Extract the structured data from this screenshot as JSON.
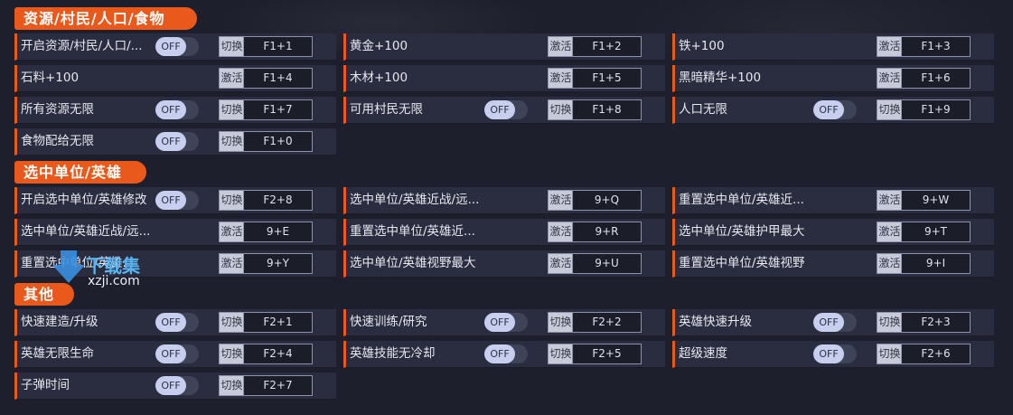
{
  "sections": [
    {
      "title": "资源/村民/人口/食物",
      "rows": [
        [
          {
            "name": "开启资源/村民/人口/...",
            "toggle": "OFF",
            "action": "切换",
            "key": "F1+1"
          },
          {
            "name": "黄金+100",
            "action": "激活",
            "key": "F1+2"
          },
          {
            "name": "铁+100",
            "action": "激活",
            "key": "F1+3"
          }
        ],
        [
          {
            "name": "石料+100",
            "action": "激活",
            "key": "F1+4"
          },
          {
            "name": "木材+100",
            "action": "激活",
            "key": "F1+5"
          },
          {
            "name": "黑暗精华+100",
            "action": "激活",
            "key": "F1+6"
          }
        ],
        [
          {
            "name": "所有资源无限",
            "toggle": "OFF",
            "action": "切换",
            "key": "F1+7"
          },
          {
            "name": "可用村民无限",
            "toggle": "OFF",
            "action": "切换",
            "key": "F1+8"
          },
          {
            "name": "人口无限",
            "toggle": "OFF",
            "action": "切换",
            "key": "F1+9"
          }
        ],
        [
          {
            "name": "食物配给无限",
            "toggle": "OFF",
            "action": "切换",
            "key": "F1+0"
          }
        ]
      ]
    },
    {
      "title": "选中单位/英雄",
      "rows": [
        [
          {
            "name": "开启选中单位/英雄修改",
            "toggle": "OFF",
            "action": "切换",
            "key": "F2+8"
          },
          {
            "name": "选中单位/英雄近战/远...",
            "action": "激活",
            "key": "9+Q"
          },
          {
            "name": "重置选中单位/英雄近...",
            "action": "激活",
            "key": "9+W"
          }
        ],
        [
          {
            "name": "选中单位/英雄近战/远...",
            "action": "激活",
            "key": "9+E"
          },
          {
            "name": "重置选中单位/英雄近...",
            "action": "激活",
            "key": "9+R"
          },
          {
            "name": "选中单位/英雄护甲最大",
            "action": "激活",
            "key": "9+T"
          }
        ],
        [
          {
            "name": "重置选中单位/英雄...",
            "action": "激活",
            "key": "9+Y"
          },
          {
            "name": "选中单位/英雄视野最大",
            "action": "激活",
            "key": "9+U"
          },
          {
            "name": "重置选中单位/英雄视野",
            "action": "激活",
            "key": "9+I"
          }
        ]
      ]
    },
    {
      "title": "其他",
      "rows": [
        [
          {
            "name": "快速建造/升级",
            "toggle": "OFF",
            "action": "切换",
            "key": "F2+1"
          },
          {
            "name": "快速训练/研究",
            "toggle": "OFF",
            "action": "切换",
            "key": "F2+2"
          },
          {
            "name": "英雄快速升级",
            "toggle": "OFF",
            "action": "切换",
            "key": "F2+3"
          }
        ],
        [
          {
            "name": "英雄无限生命",
            "toggle": "OFF",
            "action": "切换",
            "key": "F2+4"
          },
          {
            "name": "英雄技能无冷却",
            "toggle": "OFF",
            "action": "切换",
            "key": "F2+5"
          },
          {
            "name": "超级速度",
            "toggle": "OFF",
            "action": "切换",
            "key": "F2+6"
          }
        ],
        [
          {
            "name": "子弹时间",
            "toggle": "OFF",
            "action": "切换",
            "key": "F2+7"
          }
        ]
      ]
    }
  ],
  "watermark": {
    "brand": "下载集",
    "domain": "xzji.com"
  },
  "colors": {
    "accent": "#e8591b",
    "background": "#1d1f2c",
    "row": "#2a2d3f",
    "toggle_knob": "#c8cfee"
  }
}
